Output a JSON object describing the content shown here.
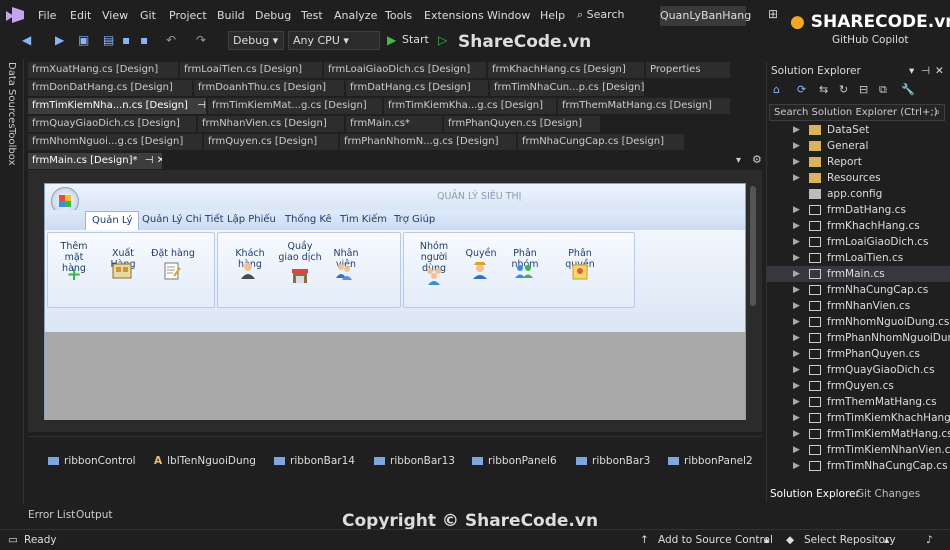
{
  "menu": [
    "File",
    "Edit",
    "View",
    "Git",
    "Project",
    "Build",
    "Debug",
    "Test",
    "Analyze",
    "Tools",
    "Extensions",
    "Window",
    "Help"
  ],
  "search_label": "Search",
  "solution_name": "QuanLyBanHang",
  "brand_text": "SHARECODE.vn",
  "toolbar": {
    "config": "Debug",
    "platform": "Any CPU",
    "start": "Start",
    "copilot": "GitHub Copilot"
  },
  "watermark_top": "ShareCode.vn",
  "left_strip": {
    "item1": "Data Sources",
    "item2": "Toolbox"
  },
  "doc_tabs": {
    "row1": [
      "frmXuatHang.cs [Design]",
      "frmLoaiTien.cs [Design]",
      "frmLoaiGiaoDich.cs [Design]",
      "frmKhachHang.cs [Design]",
      "Properties"
    ],
    "row2": [
      "frmDonDatHang.cs [Design]",
      "frmDoanhThu.cs [Design]",
      "frmDatHang.cs [Design]",
      "frmTimNhaCun...p.cs [Design]"
    ],
    "row3": [
      "frmTimKiemNha...n.cs [Design]",
      "frmTimKiemMat...g.cs [Design]",
      "frmTimKiemKha...g.cs [Design]",
      "frmThemMatHang.cs [Design]"
    ],
    "row4": [
      "frmQuayGiaoDich.cs [Design]",
      "frmNhanVien.cs [Design]",
      "frmMain.cs*",
      "frmPhanQuyen.cs [Design]"
    ],
    "row5": [
      "frmNhomNguoi...g.cs [Design]",
      "frmQuyen.cs [Design]",
      "frmPhanNhomN...g.cs [Design]",
      "frmNhaCungCap.cs [Design]"
    ],
    "active": "frmMain.cs [Design]*"
  },
  "form": {
    "title": "QUẢN LÝ SIÊU THỊ",
    "ribbon_tabs": [
      "Quản Lý",
      "Quản Lý Chi Tiết",
      "Lập Phiếu",
      "Thống Kê",
      "Tìm Kiếm",
      "Trợ Giúp"
    ],
    "items": {
      "them": "Thêm mặt hàng",
      "xuat": "Xuất Hàng",
      "dat": "Đặt hàng",
      "khach": "Khách hàng",
      "quay": "Quầy giao dịch",
      "nhanvien": "Nhân viên",
      "nhom": "Nhóm người dùng",
      "quyen": "Quyền",
      "phannhom": "Phân nhóm",
      "phanquyen": "Phân quyền"
    }
  },
  "tray": [
    "ribbonControl",
    "lblTenNguoiDung",
    "ribbonBar14",
    "ribbonBar13",
    "ribbonPanel6",
    "ribbonBar3",
    "ribbonPanel2"
  ],
  "solution_explorer": {
    "title": "Solution Explorer",
    "search": "Search Solution Explorer (Ctrl+;)",
    "nodes": [
      "DataSet",
      "General",
      "Report",
      "Resources",
      "app.config",
      "frmDatHang.cs",
      "frmKhachHang.cs",
      "frmLoaiGiaoDich.cs",
      "frmLoaiTien.cs",
      "frmMain.cs",
      "frmNhaCungCap.cs",
      "frmNhanVien.cs",
      "frmNhomNguoiDung.cs",
      "frmPhanNhomNguoiDung.cs",
      "frmPhanQuyen.cs",
      "frmQuayGiaoDich.cs",
      "frmQuyen.cs",
      "frmThemMatHang.cs",
      "frmTimKiemKhachHang.cs",
      "frmTimKiemMatHang.cs",
      "frmTimKiemNhanVien.cs",
      "frmTimNhaCungCap.cs"
    ],
    "selected": "frmMain.cs",
    "tabs": [
      "Solution Explorer",
      "Git Changes"
    ]
  },
  "bottom_tabs": [
    "Error List",
    "Output"
  ],
  "status": {
    "ready": "Ready",
    "source_control": "Add to Source Control",
    "repo": "Select Repository"
  },
  "watermark": "Copyright © ShareCode.vn"
}
